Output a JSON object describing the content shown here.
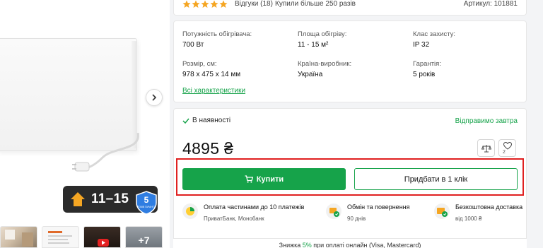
{
  "header": {
    "rating_stars": 5,
    "reviews": "Відгуки (18)",
    "sold": "Купили більше 250 разів",
    "article": "Артикул: 101881"
  },
  "specs": [
    {
      "label": "Потужність обігрівача:",
      "value": "700 Вт"
    },
    {
      "label": "Площа обігріву:",
      "value": "11 - 15 м²"
    },
    {
      "label": "Клас захисту:",
      "value": "IP 32"
    },
    {
      "label": "Розмір, см:",
      "value": "978 х 475 х 14 мм"
    },
    {
      "label": "Країна-виробник:",
      "value": "Україна"
    },
    {
      "label": "Гарантія:",
      "value": "5 років"
    }
  ],
  "all_specs_link": "Всі характеристики",
  "buy": {
    "stock": "В наявності",
    "ship": "Відправимо завтра",
    "price": "4895 ₴",
    "wishlist_count": "2",
    "buy_label": "Купити",
    "oneclick_label": "Придбати в 1 клік"
  },
  "perks": [
    {
      "title": "Оплата частинами до 10 платежів",
      "sub": "ПриватБанк, Монобанк"
    },
    {
      "title": "Обмін та повернення",
      "sub": "90 днів"
    },
    {
      "title": "Безкоштовна доставка",
      "sub": "від 1000 ₴"
    }
  ],
  "discount": {
    "prefix": "Знижка ",
    "pct": "5%",
    "suffix": " при оплаті онлайн (Visa, Mastercard)"
  },
  "gallery": {
    "area_label": "11–15",
    "warranty_years": "5",
    "warranty_text": "РОКІВ ГАРАНТІЇ",
    "more_count": "+7"
  },
  "colors": {
    "accent": "#16a34a",
    "star": "#f5a623",
    "highlight": "#e02020",
    "badge_bg": "#2b2b2b",
    "shield": "#2f7de1"
  }
}
